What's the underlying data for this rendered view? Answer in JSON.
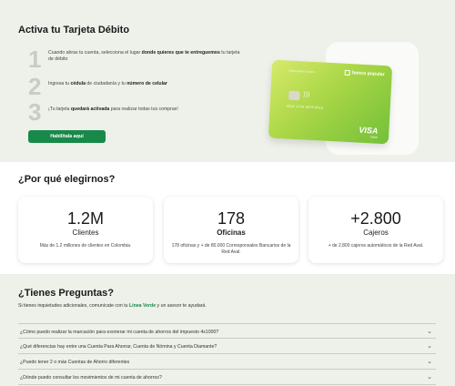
{
  "hero": {
    "title": "Activa tu Tarjeta Débito",
    "steps": [
      {
        "num": "1",
        "pre": "Cuando abras tu cuenta, selecciona el lugar ",
        "bold": "donde quieres que te entreguemos",
        "post": " tu tarjeta de débito"
      },
      {
        "num": "2",
        "pre": "Ingresa tu ",
        "bold": "cédula",
        "mid": " de ciudadanía y tu ",
        "bold2": "número de celular"
      },
      {
        "num": "3",
        "pre": "¡Tu tarjeta ",
        "bold": "quedará activada",
        "post": " para realizar todas tus compras!"
      }
    ],
    "cta_label": "Habilítala aquí",
    "card": {
      "brand_name": "banco popular",
      "caption": "Tarjeta Débito Llanero",
      "number": "4018 1234 5678 9010",
      "network": "VISA",
      "network_sub": "Débito"
    }
  },
  "why": {
    "title": "¿Por qué elegirnos?",
    "stats": [
      {
        "big": "1.2M",
        "label": "Clientes",
        "desc": "Más de 1.2 millones de clientes en Colombia."
      },
      {
        "big": "178",
        "label": "Oficinas",
        "desc": "178 oficinas y + de 80.000 Corresponsales Bancarios de la Red Aval."
      },
      {
        "big": "+2.800",
        "label": "Cajeros",
        "desc": "+ de 2.800 cajeros automáticos de la Red Aval."
      }
    ]
  },
  "faq": {
    "title": "¿Tienes Preguntas?",
    "sub_pre": "Si tienes inquietudes adicionales, comunícate con tu ",
    "sub_link": "Línea Verde",
    "sub_post": " y un asesor te ayudará.",
    "questions": [
      "¿Cómo puedo realizar la marcación para exonerar mi cuenta de ahorros del impuesto 4x1000?",
      "¿Qué diferencias hay entre una Cuenta Para Ahorrar, Cuenta de Nómina y Cuenta Diamante?",
      "¿Puedo tener 2 o más Cuentas de Ahorro diferentes",
      "¿Dónde puedo consultar los movimientos de mi cuenta de ahorros?"
    ]
  }
}
